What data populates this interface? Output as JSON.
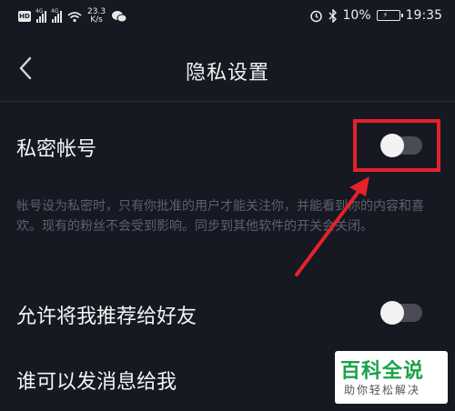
{
  "status_bar": {
    "net_speed_value": "23.3",
    "net_speed_unit": "K/s",
    "net_tag_1": "4G",
    "net_tag_2": "4G",
    "battery_percent": "10%",
    "time": "19:35"
  },
  "nav": {
    "title": "隐私设置"
  },
  "settings": {
    "private_account": {
      "label": "私密帐号",
      "enabled": false,
      "description": "帐号设为私密时，只有你批准的用户才能关注你，并能看到你的内容和喜欢。现有的粉丝不会受到影响。同步到其他软件的开关会关闭。"
    },
    "recommend_to_friends": {
      "label": "允许将我推荐给好友",
      "enabled": false
    },
    "who_can_message": {
      "label": "谁可以发消息给我"
    }
  },
  "watermark": {
    "title": "百科全说",
    "subtitle": "助你轻松解决"
  },
  "colors": {
    "background": "#161822",
    "annotation_red": "#e3222b",
    "watermark_green": "#1aa24a"
  }
}
